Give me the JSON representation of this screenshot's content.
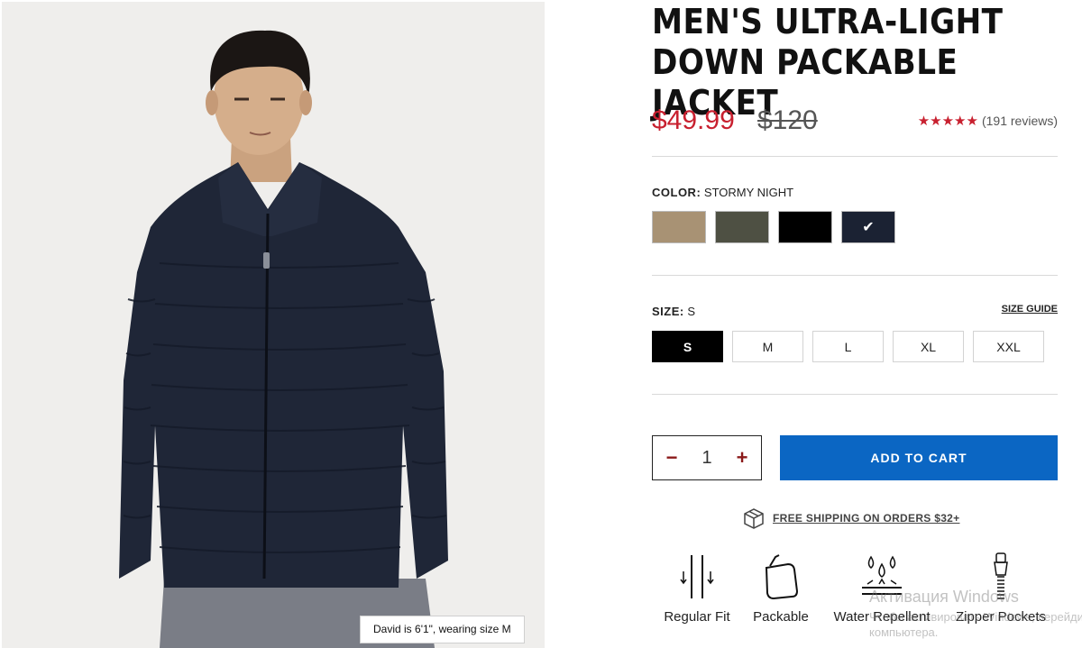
{
  "product": {
    "title": "MEN'S ULTRA-LIGHT DOWN PACKABLE JACKET",
    "sale_price": "$49.99",
    "original_price": "$120",
    "rating_stars": "★★★★★",
    "review_count": "(191 reviews)",
    "rating_color": "#c8202f",
    "sale_color": "#c8202f"
  },
  "image": {
    "caption": "David is 6'1\", wearing size M"
  },
  "color": {
    "label": "COLOR:",
    "selected": "STORMY NIGHT",
    "swatches": [
      {
        "name": "khaki",
        "hex": "#a89274"
      },
      {
        "name": "olive",
        "hex": "#4e5043"
      },
      {
        "name": "black",
        "hex": "#000000"
      },
      {
        "name": "stormy night",
        "hex": "#1b2233",
        "check": "✔"
      }
    ]
  },
  "size": {
    "label": "SIZE:",
    "selected": "S",
    "guide_label": "SIZE GUIDE",
    "options": [
      "S",
      "M",
      "L",
      "XL",
      "XXL"
    ]
  },
  "cart": {
    "minus": "−",
    "quantity": "1",
    "plus": "+",
    "add_label": "ADD TO CART",
    "button_color": "#0b66c3"
  },
  "shipping": {
    "text": "FREE SHIPPING ON ORDERS $32+",
    "icon": "box-icon"
  },
  "features": [
    {
      "label": "Regular Fit",
      "icon": "regular-fit-icon"
    },
    {
      "label": "Packable",
      "icon": "packable-icon"
    },
    {
      "label": "Water Repellent",
      "icon": "water-repellent-icon"
    },
    {
      "label": "Zipper Pockets",
      "icon": "zipper-pockets-icon"
    }
  ],
  "os_watermark": {
    "title": "Активация Windows",
    "line1": "Чтобы активировать Windows, перейдите",
    "line2": "компьютера."
  }
}
